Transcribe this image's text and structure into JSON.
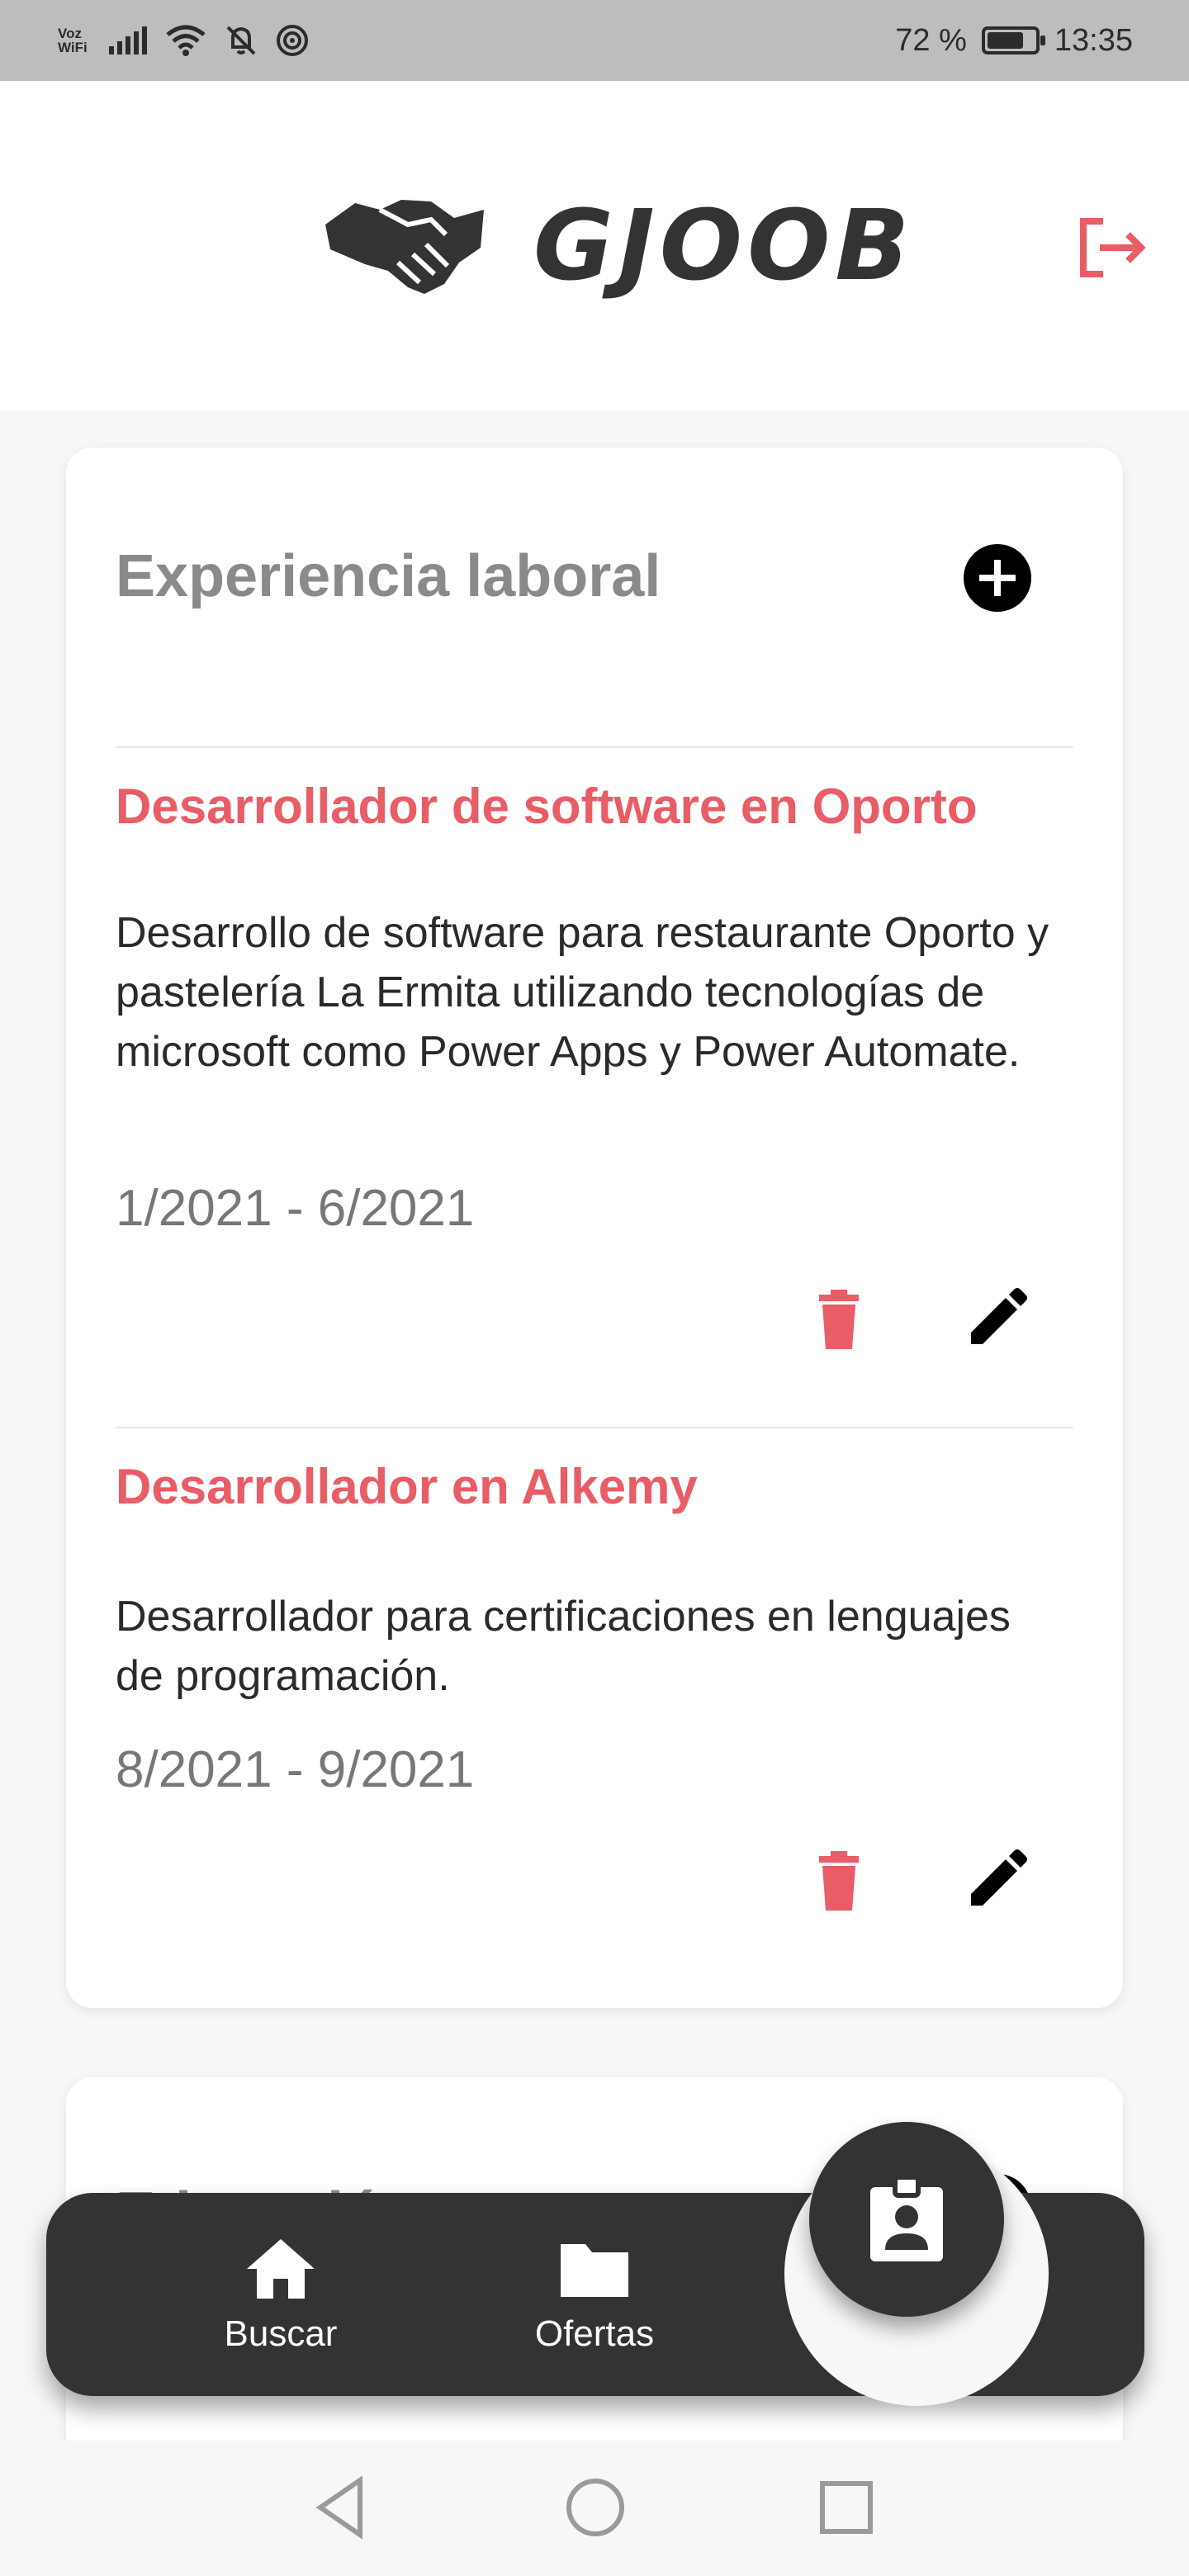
{
  "status_bar": {
    "carrier_label": "Voz WiFi",
    "battery": "72 %",
    "time": "13:35"
  },
  "header": {
    "logo_text": "GJOOB",
    "logout_icon": "logout-icon"
  },
  "experience": {
    "title": "Experiencia laboral",
    "add_icon": "plus-circle-icon",
    "items": [
      {
        "title": "Desarrollador de software en Oporto",
        "description": "Desarrollo de software para restaurante Oporto y pastelería La Ermita utilizando tecnologías de microsoft como Power Apps y Power Automate.",
        "dates": "1/2021 - 6/2021"
      },
      {
        "title": "Desarrollador en Alkemy",
        "description": "Desarrollador para certificaciones en lenguajes de programación.",
        "dates": "8/2021 - 9/2021"
      }
    ]
  },
  "education": {
    "title": "Educación"
  },
  "bottom_nav": {
    "items": [
      {
        "label": "Buscar",
        "icon": "home-icon"
      },
      {
        "label": "Ofertas",
        "icon": "folder-icon"
      }
    ],
    "fab_icon": "badge-icon"
  },
  "colors": {
    "accent": "#e85d66",
    "dark": "#333333",
    "muted_title": "#8a8a8a"
  }
}
